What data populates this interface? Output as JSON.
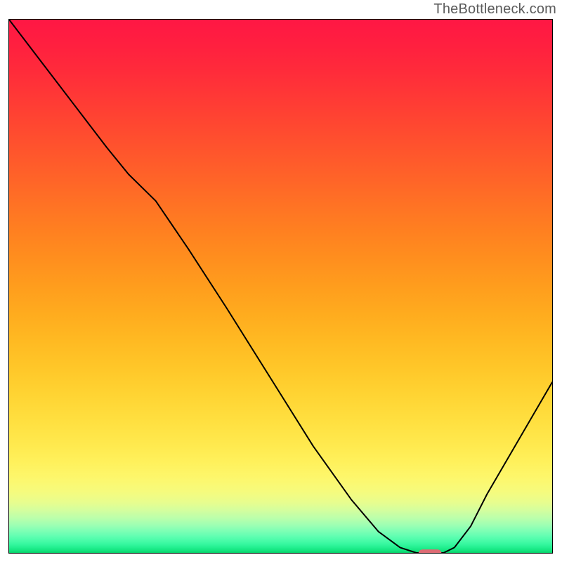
{
  "watermark": "TheBottleneck.com",
  "chart_data": {
    "type": "line",
    "title": "",
    "xlabel": "",
    "ylabel": "",
    "xlim": [
      0,
      100
    ],
    "ylim": [
      0,
      100
    ],
    "grid": false,
    "series": [
      {
        "name": "curve",
        "stroke": "#000000",
        "x": [
          0,
          6,
          12,
          18,
          22,
          27,
          33,
          40,
          48,
          56,
          63,
          68,
          72,
          75,
          78,
          80,
          82,
          85,
          88,
          92,
          96,
          100
        ],
        "y": [
          100,
          92,
          84,
          76,
          71,
          66,
          57,
          46,
          33,
          20,
          10,
          4,
          1,
          0,
          0,
          0,
          1,
          5,
          11,
          18,
          25,
          32
        ]
      }
    ],
    "marker": {
      "x_center": 77.5,
      "y_center": 0.0,
      "width": 4.2,
      "height": 1.3,
      "rx_rel": 0.6,
      "fill": "#de6b74"
    },
    "gradient_stops": [
      {
        "offset": 0.0,
        "color": "#ff1744"
      },
      {
        "offset": 0.05,
        "color": "#ff203f"
      },
      {
        "offset": 0.1,
        "color": "#ff2c3a"
      },
      {
        "offset": 0.15,
        "color": "#ff3a35"
      },
      {
        "offset": 0.2,
        "color": "#ff4830"
      },
      {
        "offset": 0.25,
        "color": "#ff562c"
      },
      {
        "offset": 0.3,
        "color": "#ff6428"
      },
      {
        "offset": 0.35,
        "color": "#ff7324"
      },
      {
        "offset": 0.4,
        "color": "#ff8120"
      },
      {
        "offset": 0.45,
        "color": "#ff8f1e"
      },
      {
        "offset": 0.5,
        "color": "#ff9d1d"
      },
      {
        "offset": 0.55,
        "color": "#ffab1e"
      },
      {
        "offset": 0.6,
        "color": "#ffb922"
      },
      {
        "offset": 0.65,
        "color": "#ffc628"
      },
      {
        "offset": 0.7,
        "color": "#ffd332"
      },
      {
        "offset": 0.75,
        "color": "#ffdf3f"
      },
      {
        "offset": 0.8,
        "color": "#ffea4f"
      },
      {
        "offset": 0.83,
        "color": "#fff15c"
      },
      {
        "offset": 0.86,
        "color": "#fdf76c"
      },
      {
        "offset": 0.885,
        "color": "#f6fb7d"
      },
      {
        "offset": 0.905,
        "color": "#e8fd8e"
      },
      {
        "offset": 0.92,
        "color": "#d4fe9e"
      },
      {
        "offset": 0.935,
        "color": "#baffab"
      },
      {
        "offset": 0.948,
        "color": "#9dffb3"
      },
      {
        "offset": 0.958,
        "color": "#80ffb5"
      },
      {
        "offset": 0.968,
        "color": "#63feb2"
      },
      {
        "offset": 0.976,
        "color": "#4cfcaa"
      },
      {
        "offset": 0.984,
        "color": "#35f79e"
      },
      {
        "offset": 0.99,
        "color": "#22ef8f"
      },
      {
        "offset": 0.996,
        "color": "#12e37d"
      },
      {
        "offset": 1.0,
        "color": "#05d369"
      }
    ]
  }
}
